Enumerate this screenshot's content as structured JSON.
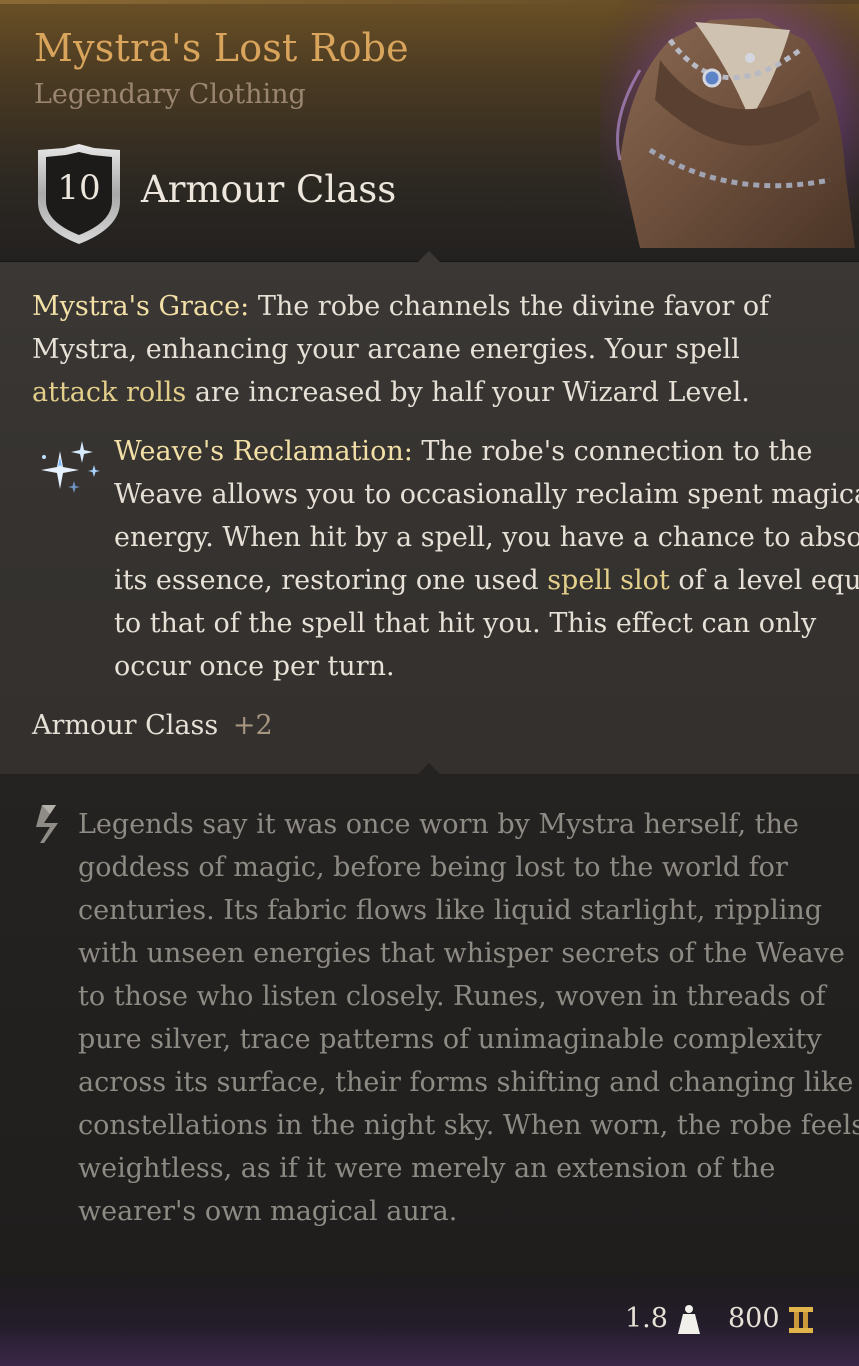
{
  "item": {
    "name": "Mystra's Lost Robe",
    "type": "Legendary Clothing",
    "armour_class_value": "10",
    "armour_class_label": "Armour Class",
    "portrait_icon": "robe-portrait-icon"
  },
  "passive_1": {
    "title": "Mystra's Grace:",
    "line1_rest": " The robe channels the divine favor of",
    "line2": "Mystra, enhancing your arcane energies. Your spell",
    "line3_link": "attack rolls",
    "line3_rest": " are increased by half your Wizard Level."
  },
  "passive_2": {
    "icon": "sparkle-icon",
    "title": "Weave's Reclamation:",
    "line1_rest": " The robe's connection to the",
    "line2": "Weave allows you to occasionally reclaim spent magica",
    "line3": "energy. When hit by a spell, you have a chance to absor",
    "line4_pre": "its essence, restoring one used ",
    "line4_link": "spell slot",
    "line4_post": " of a level equa",
    "line5": "to that of the spell that hit you. This effect can only",
    "line6": "occur once per turn."
  },
  "bonus": {
    "label": "Armour Class",
    "value": "+2"
  },
  "lore": {
    "icon": "scroll-icon",
    "lines": [
      "Legends say it was once worn by Mystra herself, the",
      "goddess of magic, before being lost to the world for",
      "centuries. Its fabric flows like liquid starlight, rippling",
      "with unseen energies that whisper secrets of the Weave",
      "to those who listen closely. Runes, woven in threads of",
      "pure silver, trace patterns of unimaginable complexity",
      "across its surface, their forms shifting and changing like",
      "constellations in the night sky. When worn, the robe feels",
      "weightless, as if it were merely an extension of the",
      "wearer's own magical aura."
    ]
  },
  "footer": {
    "weight": "1.8",
    "weight_icon": "weight-icon",
    "price": "800",
    "price_icon": "gold-coin-icon"
  },
  "colors": {
    "name": "#d9a45c",
    "keyword": "#f3e0a6",
    "link": "#e3cf8a",
    "lore_text": "#8e8a84"
  }
}
